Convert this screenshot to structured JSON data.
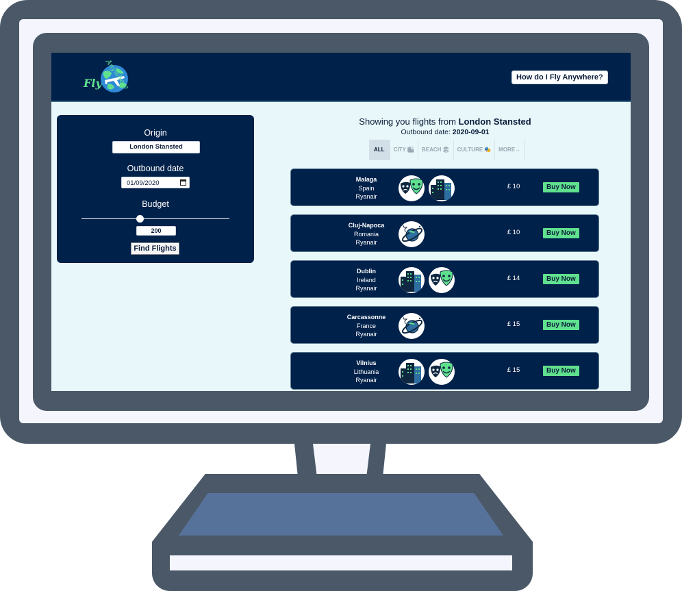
{
  "app": {
    "logo_text": "Fly",
    "logo_arc_text": "Anywhere",
    "help_button": "How do I Fly Anywhere?"
  },
  "search": {
    "origin_label": "Origin",
    "origin_value": "London Stansted",
    "date_label": "Outbound date",
    "date_value": "01/09/2020",
    "budget_label": "Budget",
    "budget_value": "200",
    "find_button": "Find Flights"
  },
  "results": {
    "title_prefix": "Showing you flights from ",
    "title_origin": "London Stansted",
    "subtitle_prefix": "Outbound date: ",
    "subtitle_date": "2020-09-01",
    "tabs": [
      {
        "label": "ALL",
        "icon": ""
      },
      {
        "label": "CITY",
        "icon": "🏙"
      },
      {
        "label": "BEACH",
        "icon": "🏖"
      },
      {
        "label": "CULTURE",
        "icon": "🎭"
      },
      {
        "label": "MORE",
        "icon": "→"
      }
    ],
    "flights": [
      {
        "city": "Malaga",
        "country": "Spain",
        "airline": "Ryanair",
        "icons": [
          "theatre-masks-icon",
          "city-buildings-icon"
        ],
        "price": "£ 10",
        "buy": "Buy Now"
      },
      {
        "city": "Cluj-Napoca",
        "country": "Romania",
        "airline": "Ryanair",
        "icons": [
          "planet-icon"
        ],
        "price": "£ 10",
        "buy": "Buy Now"
      },
      {
        "city": "Dublin",
        "country": "Ireland",
        "airline": "Ryanair",
        "icons": [
          "city-buildings-icon",
          "theatre-masks-icon"
        ],
        "price": "£ 14",
        "buy": "Buy Now"
      },
      {
        "city": "Carcassonne",
        "country": "France",
        "airline": "Ryanair",
        "icons": [
          "planet-icon"
        ],
        "price": "£ 15",
        "buy": "Buy Now"
      },
      {
        "city": "Vilnius",
        "country": "Lithuania",
        "airline": "Ryanair",
        "icons": [
          "city-buildings-icon",
          "theatre-masks-icon"
        ],
        "price": "£ 15",
        "buy": "Buy Now"
      }
    ]
  },
  "colors": {
    "navy": "#00214a",
    "accent_green": "#5fe08e",
    "monitor_frame": "#4a5868",
    "screen_bg": "#e8f7f9"
  }
}
